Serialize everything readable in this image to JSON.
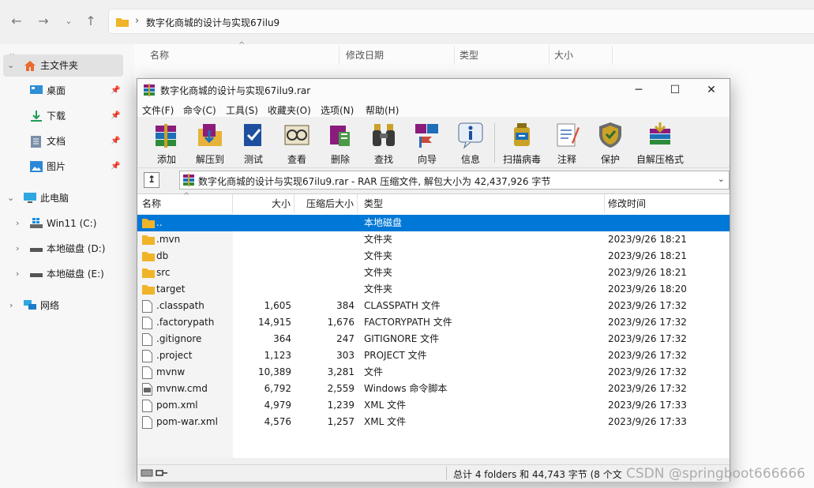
{
  "explorer": {
    "path": "数字化商城的设计与实现67ilu9",
    "sidebar": {
      "home": "主文件夹",
      "quick": [
        {
          "label": "桌面",
          "icon": "desktop-icon"
        },
        {
          "label": "下载",
          "icon": "download-icon"
        },
        {
          "label": "文档",
          "icon": "document-icon"
        },
        {
          "label": "图片",
          "icon": "picture-icon"
        }
      ],
      "this_pc": "此电脑",
      "drives": [
        "Win11 (C:)",
        "本地磁盘 (D:)",
        "本地磁盘 (E:)"
      ],
      "network": "网络"
    },
    "columns": [
      "名称",
      "修改日期",
      "类型",
      "大小"
    ]
  },
  "rar": {
    "title": "数字化商城的设计与实现67ilu9.rar",
    "menu": [
      "文件(F)",
      "命令(C)",
      "工具(S)",
      "收藏夹(O)",
      "选项(N)",
      "帮助(H)"
    ],
    "tools": [
      {
        "label": "添加",
        "icon": "add-archive-icon"
      },
      {
        "label": "解压到",
        "icon": "extract-to-icon"
      },
      {
        "label": "测试",
        "icon": "test-icon"
      },
      {
        "label": "查看",
        "icon": "view-icon"
      },
      {
        "label": "删除",
        "icon": "delete-icon"
      },
      {
        "label": "查找",
        "icon": "find-icon"
      },
      {
        "label": "向导",
        "icon": "wizard-icon"
      },
      {
        "label": "信息",
        "icon": "info-icon"
      },
      {
        "label": "扫描病毒",
        "icon": "virus-scan-icon"
      },
      {
        "label": "注释",
        "icon": "comment-icon"
      },
      {
        "label": "保护",
        "icon": "protect-icon"
      },
      {
        "label": "自解压格式",
        "icon": "sfx-icon"
      }
    ],
    "path_text": "数字化商城的设计与实现67ilu9.rar - RAR 压缩文件, 解包大小为 42,437,926 字节",
    "columns": {
      "name": "名称",
      "size": "大小",
      "packed": "压缩后大小",
      "type": "类型",
      "modified": "修改时间"
    },
    "files": [
      {
        "name": "..",
        "size": "",
        "packed": "",
        "type": "本地磁盘",
        "modified": "",
        "kind": "folder",
        "selected": true
      },
      {
        "name": ".mvn",
        "size": "",
        "packed": "",
        "type": "文件夹",
        "modified": "2023/9/26 18:21",
        "kind": "folder"
      },
      {
        "name": "db",
        "size": "",
        "packed": "",
        "type": "文件夹",
        "modified": "2023/9/26 18:21",
        "kind": "folder"
      },
      {
        "name": "src",
        "size": "",
        "packed": "",
        "type": "文件夹",
        "modified": "2023/9/26 18:21",
        "kind": "folder"
      },
      {
        "name": "target",
        "size": "",
        "packed": "",
        "type": "文件夹",
        "modified": "2023/9/26 18:20",
        "kind": "folder"
      },
      {
        "name": ".classpath",
        "size": "1,605",
        "packed": "384",
        "type": "CLASSPATH 文件",
        "modified": "2023/9/26 17:32",
        "kind": "file"
      },
      {
        "name": ".factorypath",
        "size": "14,915",
        "packed": "1,676",
        "type": "FACTORYPATH 文件",
        "modified": "2023/9/26 17:32",
        "kind": "file"
      },
      {
        "name": ".gitignore",
        "size": "364",
        "packed": "247",
        "type": "GITIGNORE 文件",
        "modified": "2023/9/26 17:32",
        "kind": "file"
      },
      {
        "name": ".project",
        "size": "1,123",
        "packed": "303",
        "type": "PROJECT 文件",
        "modified": "2023/9/26 17:32",
        "kind": "file"
      },
      {
        "name": "mvnw",
        "size": "10,389",
        "packed": "3,281",
        "type": "文件",
        "modified": "2023/9/26 17:32",
        "kind": "file"
      },
      {
        "name": "mvnw.cmd",
        "size": "6,792",
        "packed": "2,559",
        "type": "Windows 命令脚本",
        "modified": "2023/9/26 17:32",
        "kind": "script"
      },
      {
        "name": "pom.xml",
        "size": "4,979",
        "packed": "1,239",
        "type": "XML 文件",
        "modified": "2023/9/26 17:33",
        "kind": "file"
      },
      {
        "name": "pom-war.xml",
        "size": "4,576",
        "packed": "1,257",
        "type": "XML 文件",
        "modified": "2023/9/26 17:33",
        "kind": "file"
      }
    ],
    "status": "总计 4 folders 和 44,743 字节 (8 个文"
  },
  "watermark": "CSDN @springboot666666",
  "colors": {
    "selection": "#0078d7",
    "folder": "#f0b429"
  }
}
